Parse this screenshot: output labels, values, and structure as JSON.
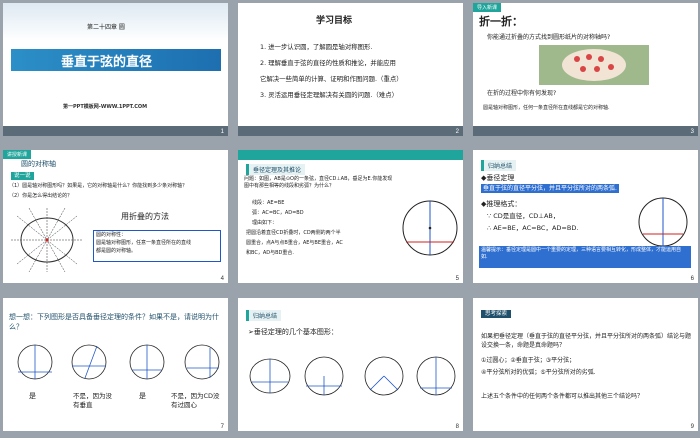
{
  "s1": {
    "chapter": "第二十四章 圆",
    "title": "垂直于弦的直径",
    "footer": "第一PPT模板网-WWW.1PPT.COM",
    "num": "1"
  },
  "s2": {
    "heading": "学习目标",
    "items": [
      "1. 进一步认识圆，了解圆是轴对称图形.",
      "2. 理解垂直于弦的直径的性质和推论，并能应用",
      "它解决一些简单的计算、证明和作图问题.（重点）",
      "3. 灵活运用垂径定理解决有关圆的问题.（难点）"
    ],
    "num": "2"
  },
  "s3": {
    "chip": "导入新课",
    "title": "折一折：",
    "q1": "你能通过折叠的方式找到圆形纸片的对称轴吗?",
    "q2": "在折的过程中你有何发现?",
    "ans": "圆是轴对称图形，任何一条直径所在直线都是它的对称轴.",
    "num": "3"
  },
  "s4": {
    "chip": "讲授新课",
    "section": "圆的对称轴",
    "label": "说一说",
    "q1": "（1）圆是轴对称图形吗？如果是，它的对称轴是什么？你能找到多少条对称轴？",
    "q2": "（2）你是怎么得出结论的？",
    "method": "用折叠的方法",
    "box": [
      "圆的对称性：",
      "圆是轴对称图形，任意一条直径所在的直线",
      "都是圆的对称轴。"
    ],
    "num": "4"
  },
  "s5": {
    "section": "垂径定理及其推论",
    "problem": "问题：如图，AB是⊙O的一条弦，直径CD⊥AB，垂足为E.你能发现图中有那些相等的线段和劣弧？为什么？",
    "lines": [
      "线段：AE=BE",
      "弧：AC=BC，AD=BD",
      "理由如下：",
      "把圆沿着直径CD折叠时，CD两侧的两个半",
      "圆重合，点A与点B重合，AE与BE重合，AC",
      "和BC，AD与BD重合."
    ],
    "num": "5"
  },
  "s6": {
    "tag": "归纳总结",
    "theorem_head": "◆垂径定理",
    "theorem": "垂直于弦的直径平分弦，并且平分弦所对的两条弧.",
    "sym_head": "◆推理格式：",
    "sym1": "∵ CD是直径，CD⊥AB，",
    "sym2": "∴ AE=BE，AC=BC，AD=BD.",
    "note": "温馨提示：垂径定理是圆中一个重要的定理，三种语言要相互转化，形成整体，才能运用自如.",
    "num": "6"
  },
  "s7": {
    "title": "想一想：下列图形是否具备垂径定理的条件？如果不是，请说明为什么？",
    "answers": [
      "是",
      "不是，因为没有垂直",
      "是",
      "不是，因为CD没有过圆心"
    ],
    "num": "7"
  },
  "s8": {
    "tag": "归纳总结",
    "title": "➢垂径定理的几个基本图形：",
    "num": "8"
  },
  "s9": {
    "tag": "思考探索",
    "p1": "如果把垂径定理（垂直于弦的直径平分弦，并且平分弦所对的两条弧）结论与题设交换一条，命题是真命题吗？",
    "items": [
      "①过圆心；②垂直于弦；③平分弦；",
      "④平分弦所对的优弧；⑤平分弦所对的劣弧."
    ],
    "final": "上述五个条件中的任何两个条件都可以推出其他三个结论吗？",
    "num": "9"
  }
}
